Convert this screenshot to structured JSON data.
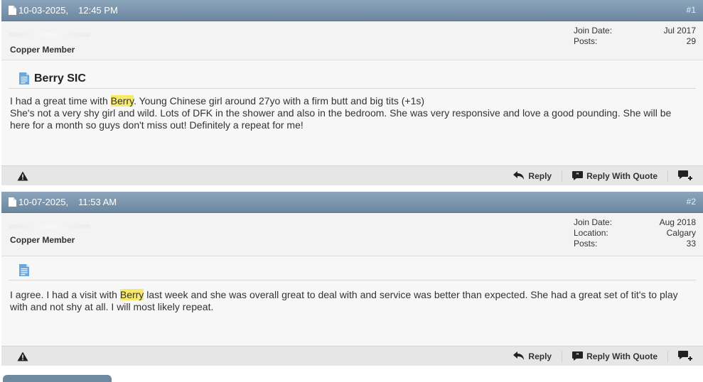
{
  "posts": [
    {
      "date": "10-03-2025,",
      "time": "12:45 PM",
      "number": "#1",
      "user_title": "Copper Member",
      "stats": [
        {
          "label": "Join Date:",
          "value": "Jul 2017"
        },
        {
          "label": "Posts:",
          "value": "29"
        }
      ],
      "title": "Berry SIC",
      "content": {
        "l1_pre": "I had a great time with ",
        "highlight": "Berry",
        "l1_post": ". Young Chinese girl around 27yo with a firm butt and big tits (+1s)",
        "rest": "She's not a very shy girl and wild. Lots of DFK in the shower and also in the bedroom. She was very responsive and love a good pounding. She will be here for a month so guys don't miss out! Definitely a repeat for me!"
      }
    },
    {
      "date": "10-07-2025,",
      "time": "11:53 AM",
      "number": "#2",
      "user_title": "Copper Member",
      "stats": [
        {
          "label": "Join Date:",
          "value": "Aug 2018"
        },
        {
          "label": "Location:",
          "value": "Calgary"
        },
        {
          "label": "Posts:",
          "value": "33"
        }
      ],
      "title": "",
      "content": {
        "pre": "I agree. I had a visit with ",
        "highlight": "Berry",
        "post": " last week and she was overall great to deal with and service was better than expected. She had a great set of tit's to play with and not shy at all. I will most likely repeat."
      }
    }
  ],
  "footer": {
    "reply_label": "Reply",
    "reply_quote_label": "Reply With Quote"
  },
  "colors": {
    "header": "#7b96ae",
    "highlight": "#f7e96a"
  }
}
